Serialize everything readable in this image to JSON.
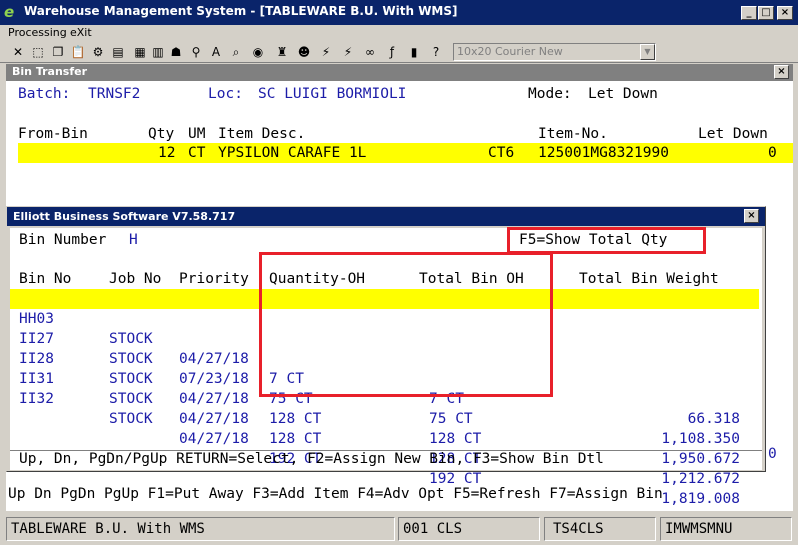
{
  "app": {
    "title": "Warehouse Management System - [TABLEWARE B.U. With WMS]",
    "menu": [
      "Processing",
      "eXit"
    ],
    "font_selector": "10x20 Courier New"
  },
  "bin_transfer": {
    "window_title": "Bin Transfer",
    "batch_label": "Batch:",
    "batch_value": "TRNSF2",
    "loc_label": "Loc:",
    "loc_value": "SC LUIGI BORMIOLI",
    "mode_label": "Mode:",
    "mode_value": "Let Down",
    "columns": {
      "from_bin": "From-Bin",
      "qty": "Qty",
      "um": "UM",
      "item_desc": "Item Desc.",
      "item_no": "Item-No.",
      "let_down": "Let Down"
    },
    "row": {
      "qty": "12",
      "um": "CT",
      "item_desc": "YPSILON CARAFE 1L",
      "code": "CT6",
      "item_no": "125001MG8321990",
      "let_down": "0"
    },
    "side_value": "0",
    "footer_keys": "Up Dn PgDn PgUp F1=Put Away F3=Add Item F4=Adv Opt F5=Refresh F7=Assign Bin"
  },
  "dialog": {
    "title": "Elliott Business Software V7.58.717",
    "bin_number_label": "Bin Number",
    "bin_number_value": "H",
    "f5_hint": "F5=Show Total Qty",
    "columns": {
      "bin_no": "Bin No",
      "job_no": "Job No",
      "priority": "Priority",
      "qty_oh": "Quantity-OH",
      "total_bin_oh": "Total Bin OH",
      "total_bin_weight": "Total Bin Weight"
    },
    "rows": [
      {
        "bin": "HH03",
        "job": "STOCK",
        "priority": "04/27/18",
        "qty_oh": "7 CT",
        "total_oh": "7 CT",
        "weight": "66.318"
      },
      {
        "bin": "II27",
        "job": "STOCK",
        "priority": "07/23/18",
        "qty_oh": "75 CT",
        "total_oh": "75 CT",
        "weight": "1,108.350"
      },
      {
        "bin": "II28",
        "job": "STOCK",
        "priority": "04/27/18",
        "qty_oh": "128 CT",
        "total_oh": "128 CT",
        "weight": "1,950.672"
      },
      {
        "bin": "II31",
        "job": "STOCK",
        "priority": "04/27/18",
        "qty_oh": "128 CT",
        "total_oh": "128 CT",
        "weight": "1,212.672"
      },
      {
        "bin": "II32",
        "job": "STOCK",
        "priority": "04/27/18",
        "qty_oh": "192 CT",
        "total_oh": "192 CT",
        "weight": "1,819.008"
      }
    ],
    "footer_keys": "Up, Dn, PgDn/PgUp RETURN=Select, F2=Assign New Bin, F3=Show Bin Dtl"
  },
  "status": {
    "company": "TABLEWARE B.U. With WMS",
    "code1": "001 CLS",
    "code2": "TS4CLS",
    "program": "IMWMSMNU"
  },
  "colors": {
    "highlight": "#ffff00",
    "data_blue": "#1c1ca8",
    "title_bar": "#0a246a",
    "annotation_red": "#e8202a"
  }
}
